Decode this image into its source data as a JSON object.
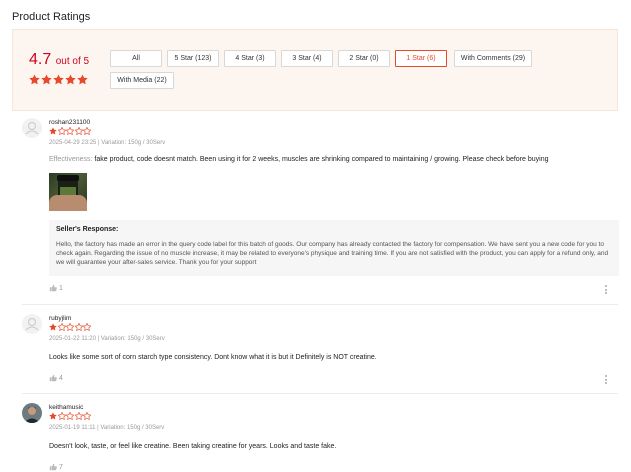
{
  "page": {
    "title": "Product Ratings"
  },
  "summary": {
    "score": "4.7",
    "out_of": "out of 5",
    "rating_stars": 5,
    "filters": [
      {
        "label": "All",
        "active": false
      },
      {
        "label": "5 Star (123)",
        "active": false
      },
      {
        "label": "4 Star (3)",
        "active": false
      },
      {
        "label": "3 Star (4)",
        "active": false
      },
      {
        "label": "2 Star (0)",
        "active": false
      },
      {
        "label": "1 Star (6)",
        "active": true
      },
      {
        "label": "With Comments (29)",
        "active": false
      },
      {
        "label": "With Media (22)",
        "active": false
      }
    ]
  },
  "colors": {
    "accent": "#e8492a",
    "score": "#d0011b",
    "summary_bg": "#fdf6f0"
  },
  "reviews": [
    {
      "username": "roshan231100",
      "rating": 1,
      "meta": "2025-04-29 23:25 | Variation: 150g / 30Serv",
      "effectiveness_label": "Effectiveness:",
      "text": "fake product, code doesnt match. Been using it for 2 weeks, muscles are shrinking compared to maintaining / growing. Please check before buying",
      "seller_response": {
        "title": "Seller's Response:",
        "text": "Hello, the factory has made an error in the query code label for this batch of goods. Our company has already contacted the factory for compensation. We have sent you a new code for you to check again. Regarding the issue of no muscle increase, it may be related to everyone's physique and training time. If you are not satisfied with the product, you can apply for a refund only, and we will guarantee your after-sales service. Thank you for your support"
      },
      "likes": "1",
      "avatar_icon": "user-placeholder-icon"
    },
    {
      "username": "rubyjlim",
      "rating": 1,
      "meta": "2025-01-22 11:20 | Variation: 150g / 30Serv",
      "text": "Looks like some sort of corn starch type consistency. Dont know what it is but it Definitely is NOT creatine.",
      "likes": "4",
      "avatar_icon": "user-placeholder-icon"
    },
    {
      "username": "keithamusic",
      "rating": 1,
      "meta": "2025-01-19 11:11 | Variation: 150g / 30Serv",
      "text": "Doesn't look, taste, or feel like creatine.   Been taking creatine for years.  Looks and taste fake.",
      "likes": "7",
      "avatar_icon": "user-photo-icon"
    }
  ]
}
